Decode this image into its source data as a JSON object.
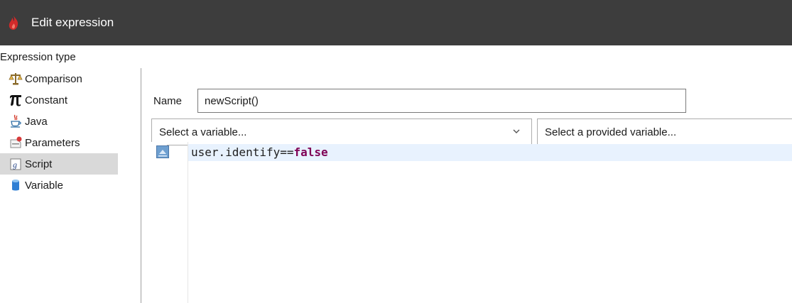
{
  "window": {
    "title": "Edit expression",
    "icon": "app-flame-icon",
    "titlebar_color": "#3d3d3d"
  },
  "expression_types": {
    "label": "Expression type",
    "selected": "Script",
    "items": [
      {
        "label": "Comparison",
        "icon": "scales-icon"
      },
      {
        "label": "Constant",
        "icon": "pi-icon"
      },
      {
        "label": "Java",
        "icon": "java-cup-icon"
      },
      {
        "label": "Parameters",
        "icon": "parameters-icon"
      },
      {
        "label": "Script",
        "icon": "script-icon"
      },
      {
        "label": "Variable",
        "icon": "database-icon"
      }
    ]
  },
  "name_field": {
    "label": "Name",
    "value": "newScript()"
  },
  "variable_select": {
    "placeholder": "Select a variable..."
  },
  "provided_variable_select": {
    "placeholder": "Select a provided variable..."
  },
  "editor": {
    "code": {
      "identifier": "user.identify",
      "operator": "==",
      "keyword": "false"
    },
    "colors": {
      "keyword": "#7f0055",
      "current_line": "#e8f2fe"
    }
  }
}
